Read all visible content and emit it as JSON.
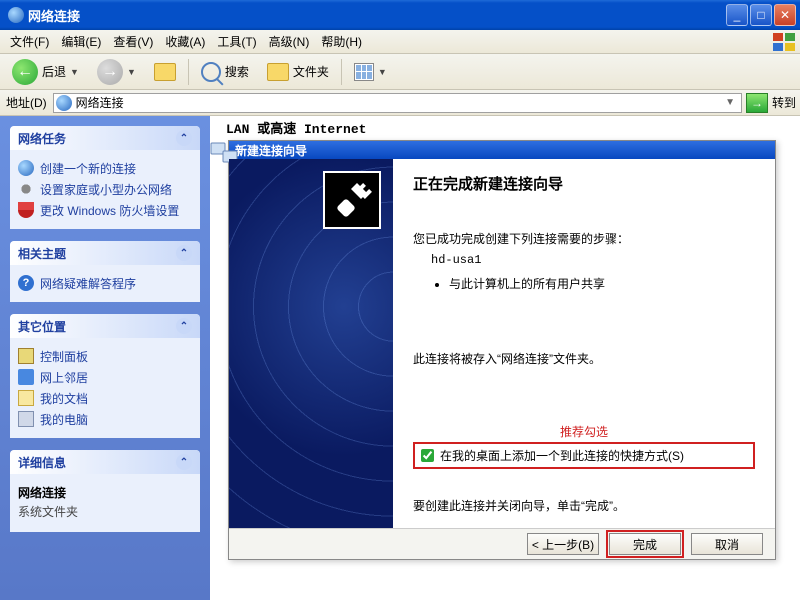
{
  "window": {
    "title": "网络连接"
  },
  "menu": {
    "items": [
      "文件(F)",
      "编辑(E)",
      "查看(V)",
      "收藏(A)",
      "工具(T)",
      "高级(N)",
      "帮助(H)"
    ]
  },
  "toolbar": {
    "back": "后退",
    "search": "搜索",
    "folders": "文件夹"
  },
  "addressbar": {
    "label": "地址(D)",
    "value": "网络连接",
    "go": "转到"
  },
  "side_panels": [
    {
      "title": "网络任务",
      "items": [
        {
          "icon": "net-icon",
          "label": "创建一个新的连接"
        },
        {
          "icon": "gears-icon",
          "label": "设置家庭或小型办公网络"
        },
        {
          "icon": "shield-icon",
          "label": "更改 Windows 防火墙设置"
        }
      ]
    },
    {
      "title": "相关主题",
      "items": [
        {
          "icon": "help-icon",
          "label": "网络疑难解答程序"
        }
      ]
    },
    {
      "title": "其它位置",
      "items": [
        {
          "icon": "cp-icon",
          "label": "控制面板"
        },
        {
          "icon": "nn-icon",
          "label": "网上邻居"
        },
        {
          "icon": "docs-icon",
          "label": "我的文档"
        },
        {
          "icon": "pc-icon",
          "label": "我的电脑"
        }
      ]
    },
    {
      "title": "详细信息",
      "plain_title": "网络连接",
      "plain_sub": "系统文件夹"
    }
  ],
  "content": {
    "section_label": "LAN 或高速 Internet"
  },
  "wizard": {
    "title": "新建连接向导",
    "heading": "正在完成新建连接向导",
    "line1": "您已成功完成创建下列连接需要的步骤：",
    "conn_name": "hd-usa1",
    "bullet": "与此计算机上的所有用户共享",
    "line2": "此连接将被存入“网络连接”文件夹。",
    "annotation": "推荐勾选",
    "checkbox_label": "在我的桌面上添加一个到此连接的快捷方式(S)",
    "line3": "要创建此连接并关闭向导，单击“完成”。",
    "buttons": {
      "back": "< 上一步(B)",
      "finish": "完成",
      "cancel": "取消"
    }
  }
}
